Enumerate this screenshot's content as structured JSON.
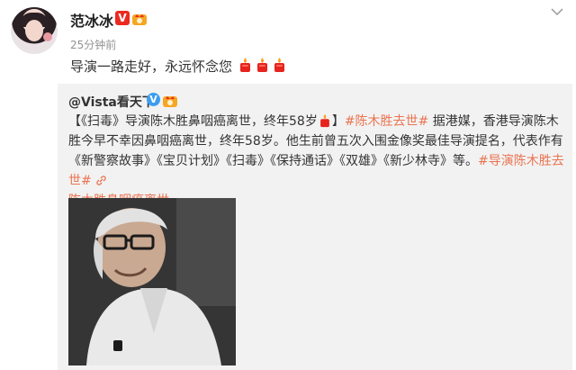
{
  "post": {
    "author": "范冰冰",
    "verified_badge": "V",
    "time": "25分钟前",
    "text": "导演一路走好，永远怀念您",
    "emoji_icons": [
      "candle-icon",
      "candle-icon",
      "candle-icon"
    ]
  },
  "repost": {
    "author": "@Vista看天下",
    "verified_badge": "V",
    "segments": [
      {
        "text": "【《扫毒》导演陈木胜鼻咽癌离世，终年58岁",
        "tag": false
      },
      {
        "text": "】",
        "tag": false
      },
      {
        "text": "#陈木胜去世#",
        "tag": true
      },
      {
        "text": " 据港媒，香港导演陈木胜今早不幸因鼻咽癌离世，终年58岁。他生前曾五次入围金像奖最佳导演提名，代表作有《新警察故事》《宝贝计划》《扫毒》《保持通话》《双雄》《新少林寺》等。",
        "tag": false
      },
      {
        "text": "#导演陈木胜去世#",
        "tag": true
      },
      {
        "text": "陈木胜鼻咽癌离世",
        "tag": true
      }
    ]
  },
  "colors": {
    "accent_link": "#eb7350",
    "verified_red": "#ea2a22",
    "verified_blue": "#3a9df3",
    "repost_bg": "#f2f2f2"
  }
}
